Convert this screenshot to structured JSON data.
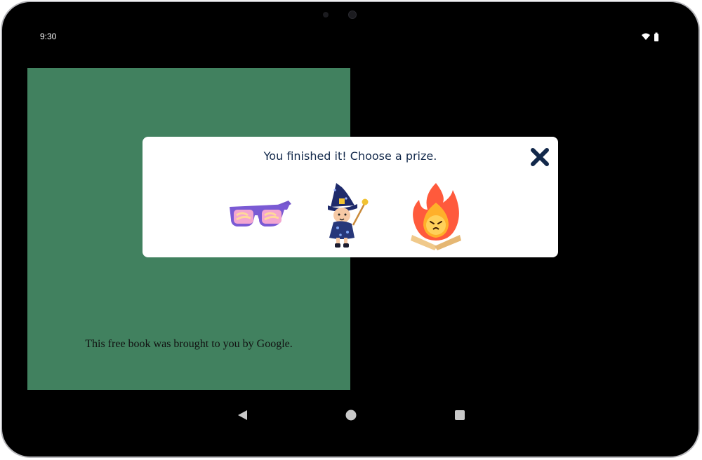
{
  "status_bar": {
    "time": "9:30",
    "icons": [
      "wifi-icon",
      "battery-icon"
    ]
  },
  "book": {
    "footer_text": "This free book was brought to you by Google.",
    "page_color": "#41815f"
  },
  "prize_dialog": {
    "title": "You finished it! Choose a prize.",
    "close_icon": "close-icon",
    "prizes": [
      {
        "icon": "glasses-icon"
      },
      {
        "icon": "wizard-icon"
      },
      {
        "icon": "campfire-icon"
      }
    ],
    "title_color": "#12284a"
  },
  "nav_bar": {
    "icons": [
      "back-icon",
      "home-icon",
      "recents-icon"
    ]
  }
}
